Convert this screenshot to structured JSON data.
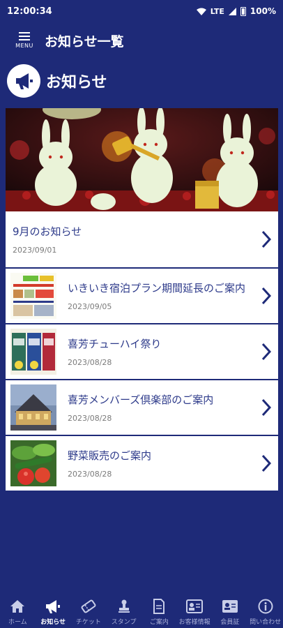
{
  "status": {
    "time": "12:00:34",
    "network": "LTE",
    "battery": "100%"
  },
  "app_bar": {
    "menu_label": "MENU",
    "title": "お知らせ一覧"
  },
  "section": {
    "title": "お知らせ"
  },
  "notices": [
    {
      "title": "9月のお知らせ",
      "date": "2023/09/01"
    },
    {
      "title": "いきいき宿泊プラン期間延長のご案内",
      "date": "2023/09/05"
    },
    {
      "title": "喜芳チューハイ祭り",
      "date": "2023/08/28"
    },
    {
      "title": "喜芳メンバーズ倶楽部のご案内",
      "date": "2023/08/28"
    },
    {
      "title": "野菜販売のご案内",
      "date": "2023/08/28"
    }
  ],
  "bottom_nav": [
    {
      "label": "ホーム",
      "icon": "home-icon"
    },
    {
      "label": "お知らせ",
      "icon": "megaphone-icon",
      "active": true
    },
    {
      "label": "チケット",
      "icon": "ticket-icon"
    },
    {
      "label": "スタンプ",
      "icon": "stamp-icon"
    },
    {
      "label": "ご案内",
      "icon": "document-icon"
    },
    {
      "label": "お客様情報",
      "icon": "id-card-icon"
    },
    {
      "label": "会員証",
      "icon": "member-card-icon"
    },
    {
      "label": "問い合わせ",
      "icon": "info-icon"
    }
  ],
  "colors": {
    "background": "#1e2a78",
    "title_text": "#2d3a8a",
    "date_text": "#7a7a7a"
  }
}
